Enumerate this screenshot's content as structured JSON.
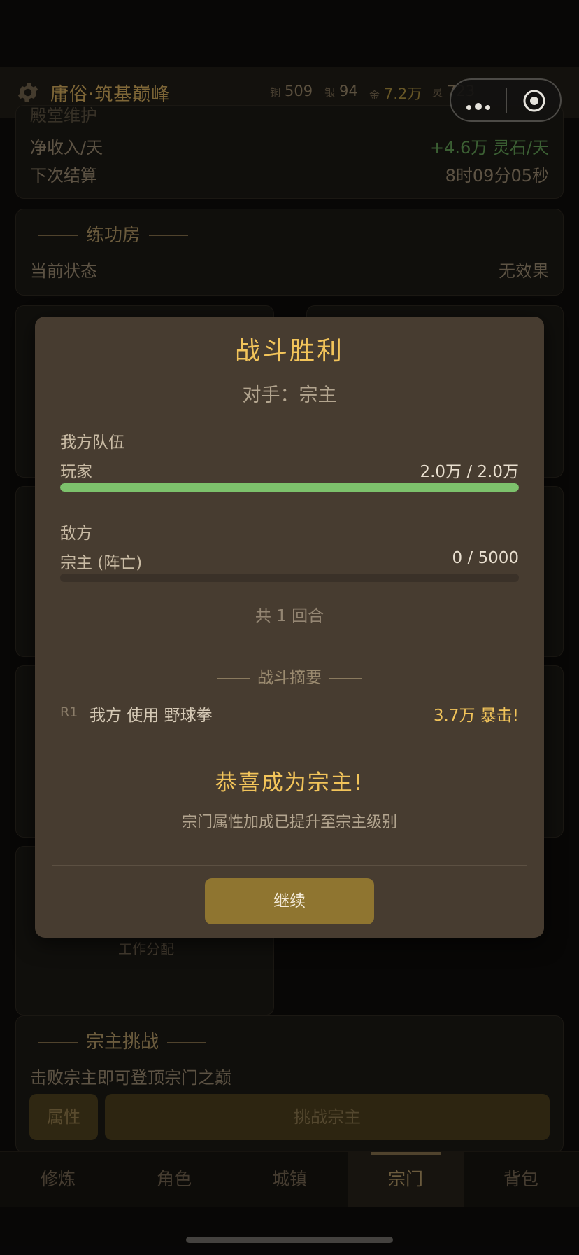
{
  "header": {
    "title": "庸俗·筑基巅峰",
    "resources": [
      {
        "key": "铜",
        "value": "509"
      },
      {
        "key": "银",
        "value": "94"
      },
      {
        "key": "金",
        "value": "7.2万"
      },
      {
        "key": "灵",
        "value": "723"
      }
    ]
  },
  "background": {
    "income": {
      "cut_label": "殿堂维护",
      "net_label": "净收入/天",
      "net_value": "+4.6万 灵石/天",
      "settle_label": "下次结算",
      "settle_value": "8时09分05秒"
    },
    "training": {
      "title": "练功房",
      "status_label": "当前状态",
      "status_value": "无效果"
    },
    "work_label": "工作分配",
    "challenge": {
      "title": "宗主挑战",
      "desc": "击败宗主即可登顶宗门之巅",
      "attr_btn": "属性",
      "challenge_btn": "挑战宗主"
    }
  },
  "nav": {
    "items": [
      "修炼",
      "角色",
      "城镇",
      "宗门",
      "背包"
    ],
    "active": "宗门"
  },
  "modal": {
    "title": "战斗胜利",
    "opponent": "对手：宗主",
    "our_team_label": "我方队伍",
    "player_name": "玩家",
    "player_hp": "2.0万 / 2.0万",
    "player_hp_fraction": 1.0,
    "enemy_label": "敌方",
    "enemy_name": "宗主 (阵亡)",
    "enemy_hp": "0 / 5000",
    "enemy_hp_fraction": 0.0,
    "rounds": "共 1 回合",
    "summary_title": "战斗摘要",
    "log": [
      {
        "round": "R1",
        "action": "我方 使用 野球拳",
        "result": "3.7万 暴击!"
      }
    ],
    "congrats": "恭喜成为宗主!",
    "congrats_sub": "宗门属性加成已提升至宗主级别",
    "continue_btn": "继续"
  },
  "colors": {
    "accent_gold": "#f2c45a",
    "hp_green": "#7dc26c",
    "button_gold": "#8f7530",
    "modal_bg": "#473c30"
  }
}
